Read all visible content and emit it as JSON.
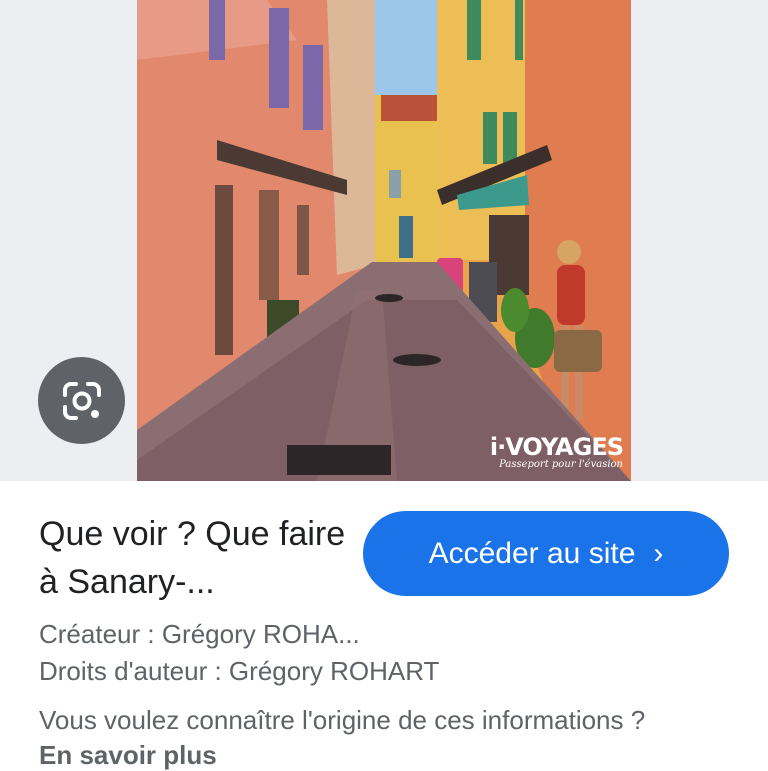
{
  "image": {
    "watermark_brand": "i·VOYAGES",
    "watermark_tagline": "Passeport pour l'évasion"
  },
  "lens_button": {
    "icon": "google-lens-icon"
  },
  "result": {
    "title": "Que voir ? Que faire à Sanary-...",
    "visit_button_label": "Accéder au site",
    "visit_button_icon": "chevron-right-icon",
    "creator": "Créateur : Grégory ROHA...",
    "copyright": "Droits d'auteur : Grégory ROHART",
    "info_question": "Vous voulez connaître l'origine de ces informations ?",
    "learn_more": "En savoir plus"
  },
  "colors": {
    "button_blue": "#1a73e8",
    "lens_gray": "#5f6368",
    "text_dark": "#202124",
    "text_gray": "#5f6368"
  }
}
